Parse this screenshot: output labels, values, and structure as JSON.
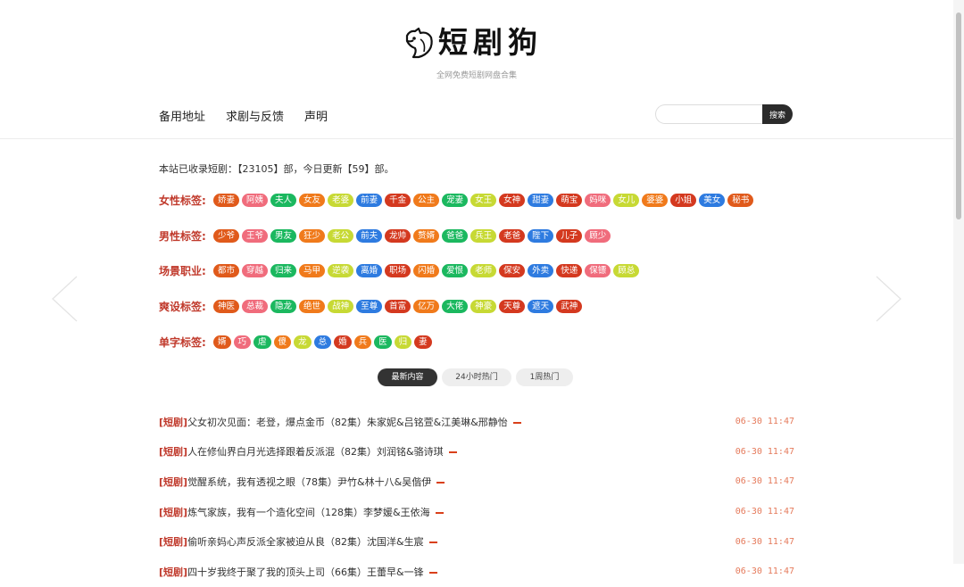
{
  "site": {
    "title": "短剧狗",
    "tagline": "全网免费短剧网盘合集"
  },
  "nav": [
    "备用地址",
    "求剧与反馈",
    "声明"
  ],
  "search": {
    "placeholder": "",
    "button": "搜索"
  },
  "stats": "本站已收录短剧：【23105】部，今日更新【59】部。",
  "tag_groups": [
    {
      "label": "女性标签:",
      "tags": [
        {
          "t": "娇妻",
          "c": "#e05a1b"
        },
        {
          "t": "阿姨",
          "c": "#f06c7c"
        },
        {
          "t": "夫人",
          "c": "#1bb85f"
        },
        {
          "t": "女友",
          "c": "#f07a1b"
        },
        {
          "t": "老婆",
          "c": "#c7d934"
        },
        {
          "t": "前妻",
          "c": "#2e7be0"
        },
        {
          "t": "千金",
          "c": "#d4391f"
        },
        {
          "t": "公主",
          "c": "#f07a1b"
        },
        {
          "t": "宠妻",
          "c": "#1bb85f"
        },
        {
          "t": "女王",
          "c": "#c7d934"
        },
        {
          "t": "女神",
          "c": "#d4391f"
        },
        {
          "t": "甜妻",
          "c": "#2e7be0"
        },
        {
          "t": "萌宝",
          "c": "#d4391f"
        },
        {
          "t": "妈咪",
          "c": "#f06c7c"
        },
        {
          "t": "女儿",
          "c": "#c7d934"
        },
        {
          "t": "婆婆",
          "c": "#f07a1b"
        },
        {
          "t": "小姐",
          "c": "#d4391f"
        },
        {
          "t": "美女",
          "c": "#2e7be0"
        },
        {
          "t": "秘书",
          "c": "#e05a1b"
        }
      ]
    },
    {
      "label": "男性标签:",
      "tags": [
        {
          "t": "少爷",
          "c": "#e05a1b"
        },
        {
          "t": "王爷",
          "c": "#f06c7c"
        },
        {
          "t": "男友",
          "c": "#1bb85f"
        },
        {
          "t": "狂少",
          "c": "#f07a1b"
        },
        {
          "t": "老公",
          "c": "#c7d934"
        },
        {
          "t": "前夫",
          "c": "#2e7be0"
        },
        {
          "t": "龙帅",
          "c": "#d4391f"
        },
        {
          "t": "赘婿",
          "c": "#f07a1b"
        },
        {
          "t": "爸爸",
          "c": "#1bb85f"
        },
        {
          "t": "兵王",
          "c": "#c7d934"
        },
        {
          "t": "老爸",
          "c": "#d4391f"
        },
        {
          "t": "陛下",
          "c": "#2e7be0"
        },
        {
          "t": "儿子",
          "c": "#d4391f"
        },
        {
          "t": "顾少",
          "c": "#f06c7c"
        }
      ]
    },
    {
      "label": "场景职业:",
      "tags": [
        {
          "t": "都市",
          "c": "#e05a1b"
        },
        {
          "t": "穿越",
          "c": "#f06c7c"
        },
        {
          "t": "归来",
          "c": "#1bb85f"
        },
        {
          "t": "马甲",
          "c": "#f07a1b"
        },
        {
          "t": "逆袭",
          "c": "#c7d934"
        },
        {
          "t": "离婚",
          "c": "#2e7be0"
        },
        {
          "t": "职场",
          "c": "#d4391f"
        },
        {
          "t": "闪婚",
          "c": "#f07a1b"
        },
        {
          "t": "爱恨",
          "c": "#1bb85f"
        },
        {
          "t": "老师",
          "c": "#c7d934"
        },
        {
          "t": "保安",
          "c": "#d4391f"
        },
        {
          "t": "外卖",
          "c": "#2e7be0"
        },
        {
          "t": "快递",
          "c": "#d4391f"
        },
        {
          "t": "保镖",
          "c": "#f06c7c"
        },
        {
          "t": "顾总",
          "c": "#c7d934"
        }
      ]
    },
    {
      "label": "爽设标签:",
      "tags": [
        {
          "t": "神医",
          "c": "#e05a1b"
        },
        {
          "t": "总裁",
          "c": "#f06c7c"
        },
        {
          "t": "隐龙",
          "c": "#1bb85f"
        },
        {
          "t": "绝世",
          "c": "#f07a1b"
        },
        {
          "t": "战神",
          "c": "#c7d934"
        },
        {
          "t": "至尊",
          "c": "#2e7be0"
        },
        {
          "t": "首富",
          "c": "#d4391f"
        },
        {
          "t": "亿万",
          "c": "#f07a1b"
        },
        {
          "t": "大佬",
          "c": "#1bb85f"
        },
        {
          "t": "神豪",
          "c": "#c7d934"
        },
        {
          "t": "天尊",
          "c": "#d4391f"
        },
        {
          "t": "遮天",
          "c": "#2e7be0"
        },
        {
          "t": "武神",
          "c": "#d4391f"
        }
      ]
    },
    {
      "label": "单字标签:",
      "tags": [
        {
          "t": "婿",
          "c": "#e05a1b"
        },
        {
          "t": "巧",
          "c": "#f06c7c"
        },
        {
          "t": "虐",
          "c": "#1bb85f"
        },
        {
          "t": "傻",
          "c": "#f07a1b"
        },
        {
          "t": "龙",
          "c": "#c7d934"
        },
        {
          "t": "总",
          "c": "#2e7be0"
        },
        {
          "t": "婚",
          "c": "#d4391f"
        },
        {
          "t": "兵",
          "c": "#f07a1b"
        },
        {
          "t": "医",
          "c": "#1bb85f"
        },
        {
          "t": "归",
          "c": "#c7d934"
        },
        {
          "t": "妻",
          "c": "#d4391f"
        }
      ]
    }
  ],
  "tabs": [
    {
      "label": "最新内容",
      "active": true
    },
    {
      "label": "24小时热门",
      "active": false
    },
    {
      "label": "1周热门",
      "active": false
    }
  ],
  "list": [
    {
      "cat": "[短剧]",
      "title": "父女初次见面：老登，爆点金币（82集）朱家妮&吕铭萱&江美琳&邢静怡",
      "date": "06-30 11:47"
    },
    {
      "cat": "[短剧]",
      "title": "人在修仙界白月光选择跟着反派混（82集）刘润铭&骆诗琪",
      "date": "06-30 11:47"
    },
    {
      "cat": "[短剧]",
      "title": "觉醒系统，我有透视之眼（78集）尹竹&林十八&吴偕伊",
      "date": "06-30 11:47"
    },
    {
      "cat": "[短剧]",
      "title": "炼气家族，我有一个造化空间（128集）李梦媛&王依海",
      "date": "06-30 11:47"
    },
    {
      "cat": "[短剧]",
      "title": "偷听亲妈心声反派全家被迫从良（82集）沈国洋&生宸",
      "date": "06-30 11:47"
    },
    {
      "cat": "[短剧]",
      "title": "四十岁我终于聚了我的顶头上司（66集）王蕾早&一锋",
      "date": "06-30 11:47"
    }
  ]
}
